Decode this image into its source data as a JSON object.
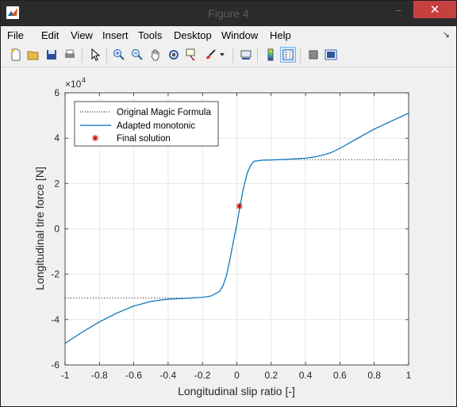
{
  "window": {
    "title": "Figure 4",
    "app_icon": "matlab-icon",
    "controls": {
      "minimize": "–",
      "maximize": "▢",
      "close": "✕"
    }
  },
  "menu": {
    "items": [
      "File",
      "Edit",
      "View",
      "Insert",
      "Tools",
      "Desktop",
      "Window",
      "Help"
    ],
    "dock_icon": "↘"
  },
  "toolbar": {
    "buttons": [
      "new-figure-icon",
      "open-file-icon",
      "save-icon",
      "print-icon",
      "pointer-icon",
      "zoom-in-icon",
      "zoom-out-icon",
      "pan-icon",
      "rotate-icon",
      "data-cursor-icon",
      "brush-icon",
      "brush-dropdown-icon",
      "link-plot-icon",
      "colorbar-icon",
      "legend-icon",
      "hide-plot-tools-icon",
      "show-plot-tools-icon"
    ],
    "active": [
      "legend-icon"
    ]
  },
  "colors": {
    "series_original": "#000000",
    "series_adapted": "#0072bd",
    "marker": "#cc0000",
    "grid": "#e2e2e2"
  },
  "chart_data": {
    "type": "line",
    "xlabel": "Longitudinal slip ratio [-]",
    "ylabel": "Longitudinal tire force [N]",
    "y_exponent_label": "×10",
    "y_exponent_power": "4",
    "xlim": [
      -1,
      1
    ],
    "ylim": [
      -60000,
      60000
    ],
    "x_ticks": [
      -1,
      -0.8,
      -0.6,
      -0.4,
      -0.2,
      0,
      0.2,
      0.4,
      0.6,
      0.8,
      1
    ],
    "x_tick_labels": [
      "-1",
      "-0.8",
      "-0.6",
      "-0.4",
      "-0.2",
      "0",
      "0.2",
      "0.4",
      "0.6",
      "0.8",
      "1"
    ],
    "y_ticks": [
      -60000,
      -40000,
      -20000,
      0,
      20000,
      40000,
      60000
    ],
    "y_tick_labels": [
      "-6",
      "-4",
      "-2",
      "0",
      "2",
      "4",
      "6"
    ],
    "grid": true,
    "legend_position": "top-left",
    "series": [
      {
        "name": "Original Magic Formula",
        "style": "dotted",
        "x": [
          -1,
          -0.8,
          -0.6,
          -0.5,
          -0.4,
          -0.3,
          -0.2,
          -0.15,
          -0.1,
          -0.08,
          -0.06,
          -0.04,
          -0.02,
          0,
          0.02,
          0.04,
          0.06,
          0.08,
          0.1,
          0.15,
          0.2,
          0.3,
          0.4,
          0.5,
          0.6,
          0.8,
          1
        ],
        "y": [
          -30500,
          -30500,
          -30500,
          -30500,
          -30500,
          -30500,
          -30200,
          -29600,
          -27500,
          -25000,
          -20500,
          -13500,
          -5500,
          2000,
          10500,
          18500,
          24500,
          28000,
          29800,
          30300,
          30400,
          30500,
          30500,
          30500,
          30500,
          30500,
          30500
        ]
      },
      {
        "name": "Adapted monotonic",
        "style": "solid",
        "x": [
          -1,
          -0.9,
          -0.8,
          -0.7,
          -0.6,
          -0.5,
          -0.45,
          -0.4,
          -0.3,
          -0.2,
          -0.15,
          -0.1,
          -0.08,
          -0.06,
          -0.04,
          -0.02,
          0,
          0.02,
          0.04,
          0.06,
          0.08,
          0.1,
          0.15,
          0.2,
          0.3,
          0.4,
          0.45,
          0.5,
          0.55,
          0.6,
          0.7,
          0.8,
          0.9,
          1
        ],
        "y": [
          -50500,
          -45500,
          -41000,
          -37200,
          -34000,
          -32000,
          -31400,
          -31000,
          -30600,
          -30200,
          -29600,
          -27500,
          -25000,
          -20500,
          -13500,
          -5500,
          2000,
          10500,
          18500,
          24500,
          28000,
          29800,
          30300,
          30400,
          30700,
          31200,
          31700,
          32500,
          33700,
          35500,
          39800,
          44000,
          47500,
          51000
        ]
      },
      {
        "name": "Final solution",
        "style": "marker-star",
        "x": [
          0.015
        ],
        "y": [
          10000
        ]
      }
    ]
  }
}
